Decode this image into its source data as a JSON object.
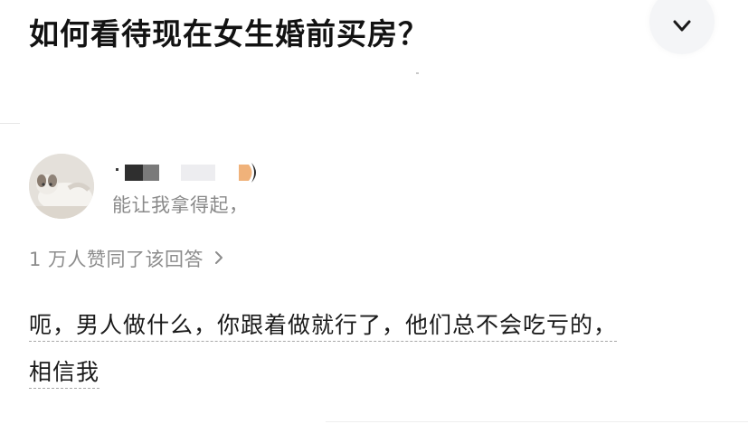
{
  "question": {
    "title": "如何看待现在女生婚前买房？"
  },
  "author": {
    "bio": "能让我拿得起，"
  },
  "endorsement": {
    "text": "1 万人赞同了该回答"
  },
  "answer": {
    "lines": [
      "呃，男人做什么，你跟着做就行了，他们总不会吃亏的，",
      "相信我"
    ]
  },
  "icons": {
    "collapse": "chevron-down-icon",
    "endorse_arrow": "chevron-right-icon"
  },
  "colors": {
    "title": "#121212",
    "secondary_text": "#8a8a8a",
    "collapse_bg": "#f4f5f7",
    "underline": "#a8a8a8"
  }
}
